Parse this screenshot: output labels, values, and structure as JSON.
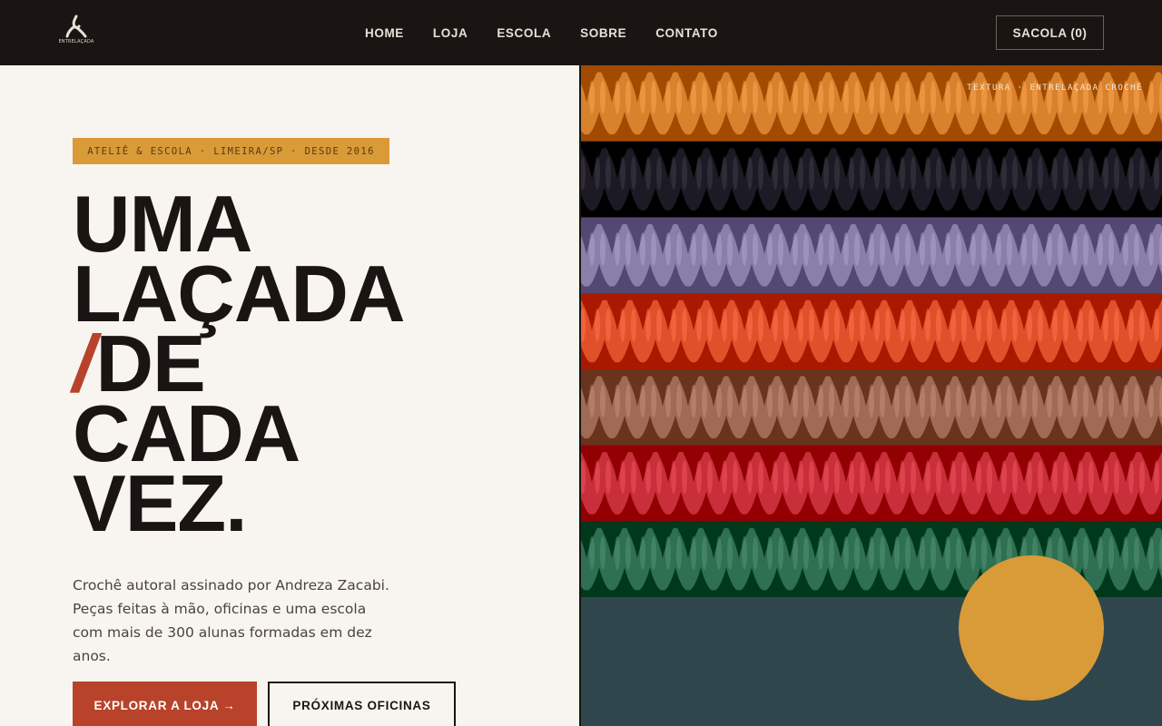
{
  "header": {
    "logo_text": "ENTRELAÇADA",
    "nav": [
      "HOME",
      "LOJA",
      "ESCOLA",
      "SOBRE",
      "CONTATO"
    ],
    "cart_label": "SACOLA (0)"
  },
  "hero": {
    "tag": "ATELIÊ & ESCOLA · LIMEIRA/SP · DESDE 2016",
    "headline": {
      "line1": "UMA",
      "line2": "LAÇADA",
      "slash": "/",
      "line3": "DE",
      "line4": "CADA",
      "line5": "VEZ."
    },
    "description": "Crochê autoral assinado por Andreza Zacabi. Peças feitas à mão, oficinas e uma escola com mais de 300 alunas formadas em dez anos.",
    "primary_button": "EXPLORAR A LOJA →",
    "secondary_button": "PRÓXIMAS OFICINAS"
  },
  "visual": {
    "caption": "TEXTURA · ENTRELAÇADA CROCHÊ",
    "stripe_colors": [
      "#d9822e",
      "#1c1a24",
      "#8a7fa8",
      "#e0502a",
      "#a06a55",
      "#c92f3a",
      "#2f6f52"
    ],
    "accent_color": "#d99a38",
    "teal_color": "#2f474c",
    "brand_red": "#b8432a"
  }
}
